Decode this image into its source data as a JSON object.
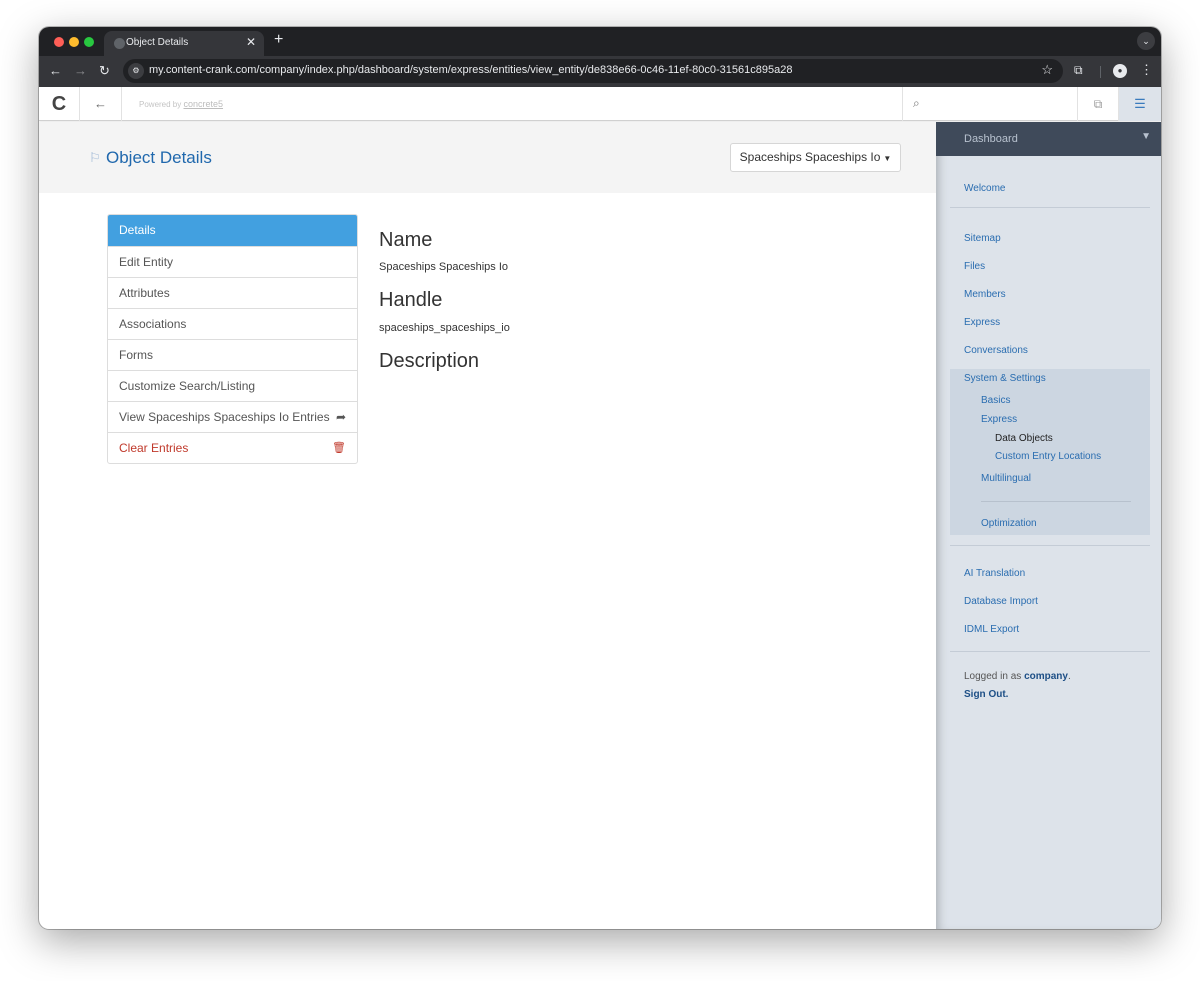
{
  "browser": {
    "tab_title": "Object Details",
    "url": "my.content-crank.com/company/index.php/dashboard/system/express/entities/view_entity/de838e66-0c46-11ef-80c0-31561c895a28"
  },
  "toolbar": {
    "powered_by": "Powered by",
    "powered_by_link": "concrete5"
  },
  "header": {
    "title": "Object Details",
    "entity_selector": "Spaceships Spaceships Io"
  },
  "menu": {
    "items": [
      {
        "label": "Details"
      },
      {
        "label": "Edit Entity"
      },
      {
        "label": "Attributes"
      },
      {
        "label": "Associations"
      },
      {
        "label": "Forms"
      },
      {
        "label": "Customize Search/Listing"
      },
      {
        "label": "View Spaceships Spaceships Io Entries"
      },
      {
        "label": "Clear Entries"
      }
    ]
  },
  "details": {
    "name_heading": "Name",
    "name_value": "Spaceships Spaceships Io",
    "handle_heading": "Handle",
    "handle_value": "spaceships_spaceships_io",
    "description_heading": "Description"
  },
  "dashboard": {
    "title": "Dashboard",
    "welcome": "Welcome",
    "sitemap": "Sitemap",
    "files": "Files",
    "members": "Members",
    "express": "Express",
    "conversations": "Conversations",
    "system_settings": "System & Settings",
    "basics": "Basics",
    "express_sub": "Express",
    "data_objects": "Data Objects",
    "custom_entry_locations": "Custom Entry Locations",
    "multilingual": "Multilingual",
    "optimization": "Optimization",
    "ai_translation": "AI Translation",
    "database_import": "Database Import",
    "idml_export": "IDML Export",
    "logged_in_as": "Logged in as",
    "user": "company",
    "sign_out": "Sign Out."
  },
  "colors": {
    "active_menu": "#42a0e0",
    "link": "#2a6db0",
    "danger": "#c0392b"
  }
}
